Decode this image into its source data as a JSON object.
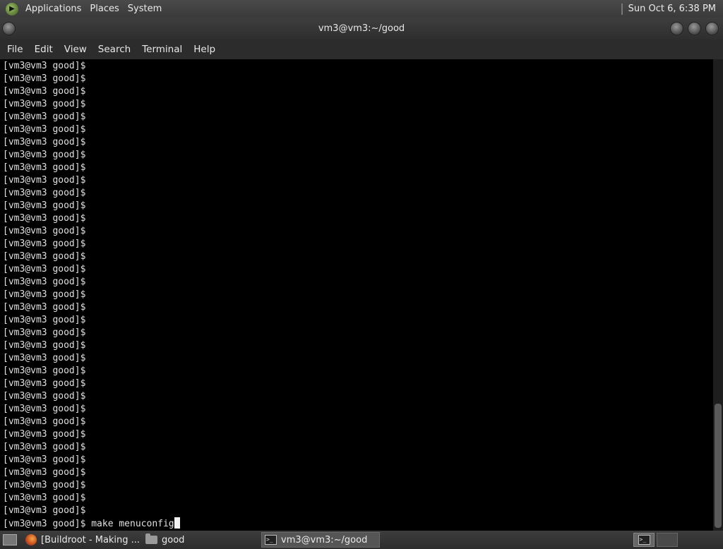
{
  "top_panel": {
    "menus": [
      "Applications",
      "Places",
      "System"
    ],
    "clock": "Sun Oct  6,  6:38 PM"
  },
  "window": {
    "title": "vm3@vm3:~/good"
  },
  "menubar": {
    "items": [
      "File",
      "Edit",
      "View",
      "Search",
      "Terminal",
      "Help"
    ]
  },
  "terminal": {
    "prompt": "[vm3@vm3 good]$",
    "empty_prompt_count": 36,
    "current_command": "make menuconfig"
  },
  "taskbar": {
    "tasks": [
      {
        "label": "[Buildroot - Making ...",
        "icon": "firefox-icon"
      },
      {
        "label": "good",
        "icon": "folder-icon"
      },
      {
        "label": "vm3@vm3:~/good",
        "icon": "terminal-icon",
        "active": true
      }
    ]
  }
}
